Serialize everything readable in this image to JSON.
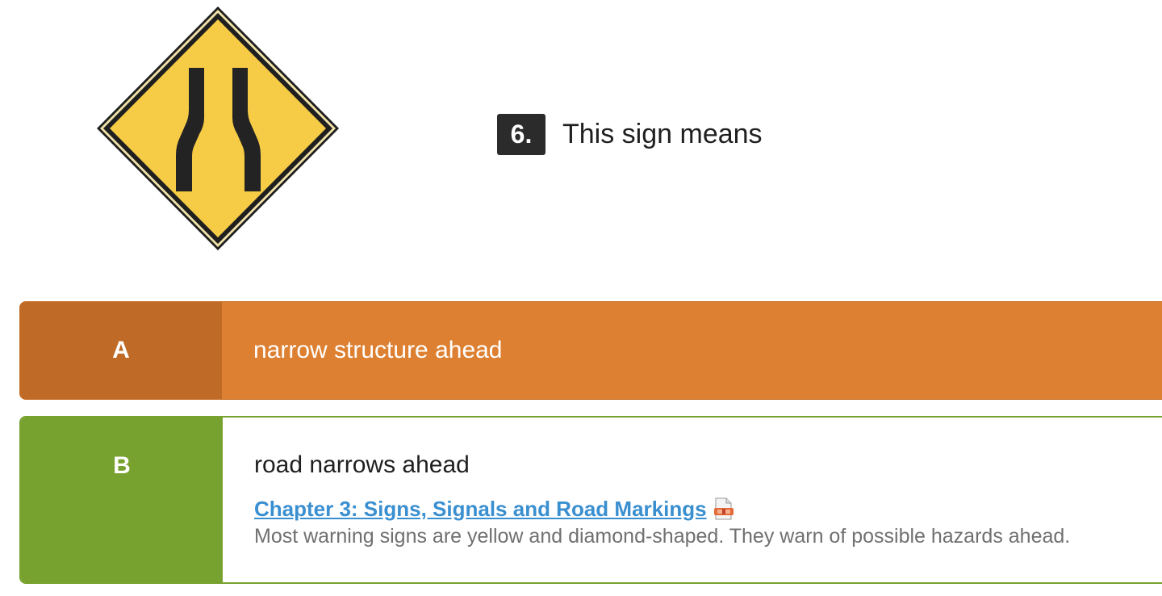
{
  "sign": {
    "icon": "road-narrows-sign",
    "colors": {
      "fill": "#f5c842",
      "border": "#1f1f1f",
      "symbol": "#222222"
    }
  },
  "question": {
    "number": "6.",
    "text": "This sign means"
  },
  "answers": [
    {
      "letter": "A",
      "text": "narrow structure ahead",
      "state": "incorrect",
      "colors": {
        "body": "#dd8031",
        "letter_bg": "#bf6b27"
      }
    },
    {
      "letter": "B",
      "text": "road narrows ahead",
      "state": "correct",
      "colors": {
        "accent": "#78a22f"
      },
      "reference": {
        "link_text": "Chapter 3: Signs, Signals and Road Markings",
        "icon": "document-link-icon",
        "explanation": "Most warning signs are yellow and diamond-shaped. They warn of possible hazards ahead."
      }
    }
  ]
}
